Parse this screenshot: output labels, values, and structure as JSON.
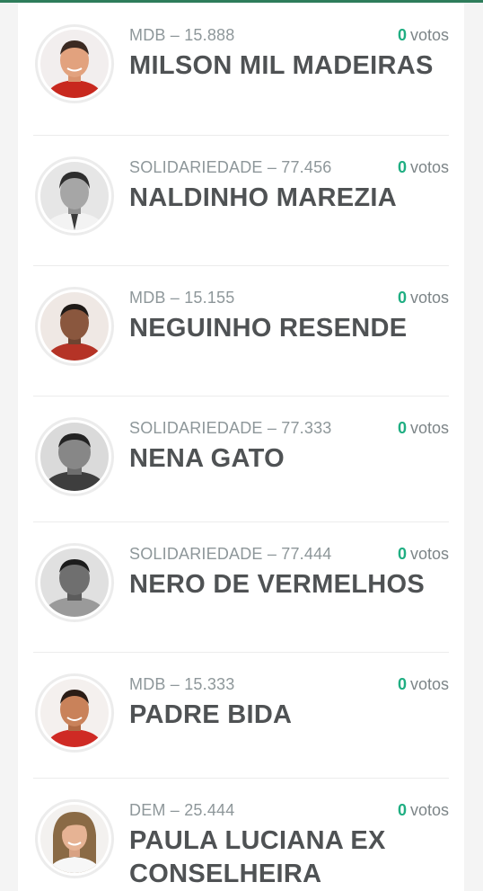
{
  "candidates": [
    {
      "party": "MDB – 15.888",
      "name": "MILSON MIL MADEIRAS",
      "votes": "0",
      "votes_label": "votos",
      "photo": "color"
    },
    {
      "party": "SOLIDARIEDADE – 77.456",
      "name": "NALDINHO MAREZIA",
      "votes": "0",
      "votes_label": "votos",
      "photo": "grayscale"
    },
    {
      "party": "MDB – 15.155",
      "name": "NEGUINHO RESENDE",
      "votes": "0",
      "votes_label": "votos",
      "photo": "color"
    },
    {
      "party": "SOLIDARIEDADE – 77.333",
      "name": "NENA GATO",
      "votes": "0",
      "votes_label": "votos",
      "photo": "grayscale"
    },
    {
      "party": "SOLIDARIEDADE – 77.444",
      "name": "NERO DE VERMELHOS",
      "votes": "0",
      "votes_label": "votos",
      "photo": "grayscale"
    },
    {
      "party": "MDB – 15.333",
      "name": "PADRE BIDA",
      "votes": "0",
      "votes_label": "votos",
      "photo": "color"
    },
    {
      "party": "DEM – 25.444",
      "name": "PAULA LUCIANA EX CONSELHEIRA",
      "votes": "0",
      "votes_label": "votos",
      "photo": "color"
    }
  ],
  "colors": {
    "accent": "#1fae82",
    "top_bar": "#2e7d5b",
    "name_text": "#4f5254",
    "party_text": "#8e979a"
  }
}
